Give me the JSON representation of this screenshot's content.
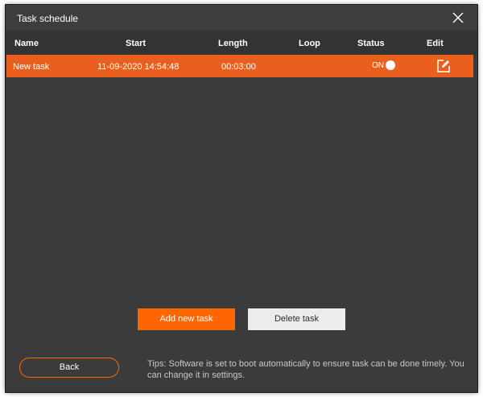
{
  "window": {
    "title": "Task schedule"
  },
  "table": {
    "headers": [
      "Name",
      "Start",
      "Length",
      "Loop",
      "Status",
      "Edit"
    ],
    "rows": [
      {
        "name": "New task",
        "start": "11-09-2020 14:54:48",
        "length": "00:03:00",
        "loop": "",
        "status": "ON"
      }
    ]
  },
  "buttons": {
    "add": "Add new task",
    "delete": "Delete task",
    "back": "Back"
  },
  "tips": "Tips: Software is set to boot automatically to ensure task can be done timely. You can change it in settings.",
  "colors": {
    "accent": "#ea5f1e",
    "background": "#3b3b3b"
  },
  "icons": {
    "close": "close-icon",
    "edit": "edit-icon"
  }
}
